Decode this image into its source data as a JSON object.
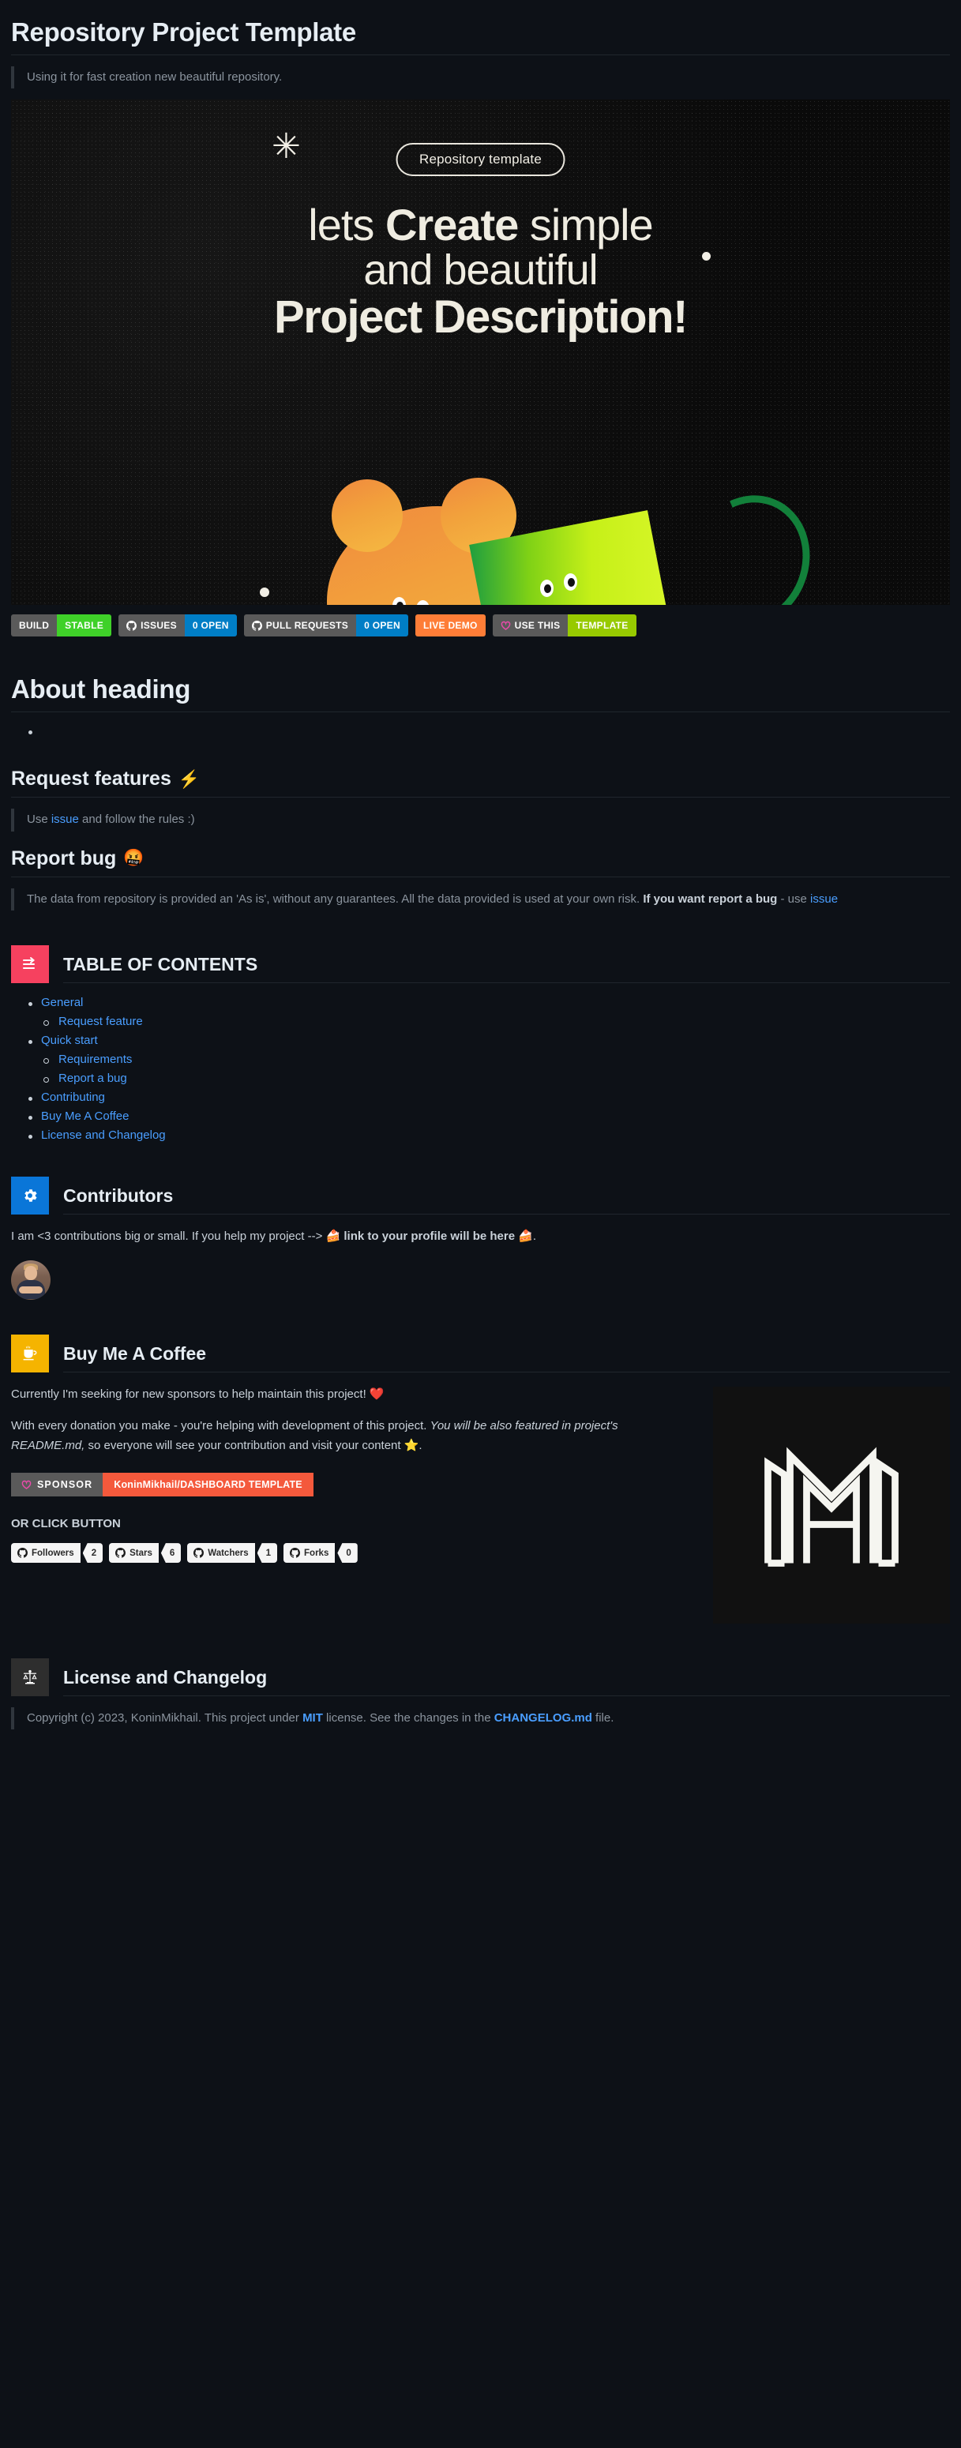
{
  "page": {
    "title": "Repository Project Template",
    "subtitle": "Using it for fast creation new beautiful repository."
  },
  "hero": {
    "pill_label": "Repository template",
    "line1_plain_a": "lets ",
    "line1_bold": "Create",
    "line1_plain_b": " simple",
    "line2": "and beautiful",
    "line3": "Project Description!"
  },
  "badges": [
    {
      "left": "BUILD",
      "right": "STABLE",
      "right_color": "#3fd129",
      "icon": ""
    },
    {
      "left": "ISSUES",
      "right": "0 OPEN",
      "right_color": "#007ec6",
      "icon": "github-icon"
    },
    {
      "left": "PULL REQUESTS",
      "right": "0 OPEN",
      "right_color": "#007ec6",
      "icon": "github-icon"
    },
    {
      "left": "LIVE DEMO",
      "right": "",
      "right_color": "",
      "icon": "",
      "solo_color": "#fe7d37"
    },
    {
      "left": "USE THIS",
      "right": "TEMPLATE",
      "right_color": "#97ca00",
      "icon": "heart-icon"
    }
  ],
  "about": {
    "heading": "About heading",
    "items": [
      ""
    ]
  },
  "request_features": {
    "heading": "Request features",
    "emoji": "⚡",
    "quote_prefix": "Use ",
    "quote_link": "issue",
    "quote_suffix": " and follow the rules :)"
  },
  "report_bug": {
    "heading": "Report bug",
    "emoji": "🤬",
    "quote_part1": "The data from repository is provided an 'As is', without any guarantees. All the data provided is used at your own risk. ",
    "quote_bold": "If you want report a bug",
    "quote_part2": " - use ",
    "quote_link": "issue"
  },
  "toc": {
    "title": "TABLE OF CONTENTS",
    "icon": "list-arrow-icon",
    "tile_color": "#f6415f",
    "items": [
      {
        "label": "General",
        "children": [
          {
            "label": "Request feature"
          }
        ]
      },
      {
        "label": "Quick start",
        "children": [
          {
            "label": "Requirements"
          },
          {
            "label": "Report a bug"
          }
        ]
      },
      {
        "label": "Contributing",
        "children": []
      },
      {
        "label": "Buy Me A Coffee",
        "children": []
      },
      {
        "label": "License and Changelog",
        "children": []
      }
    ]
  },
  "contributors": {
    "title": "Contributors",
    "icon": "gear-icon",
    "tile_color": "#0a76d8",
    "paragraph_plain": "I am <3 contributions big or small. If you help my project --> ",
    "paragraph_bold": "🍰 link to your profile will be here 🍰",
    "paragraph_end": ".",
    "avatar_alt": "contributor-avatar"
  },
  "coffee": {
    "title": "Buy Me A Coffee",
    "icon": "coffee-cup-icon",
    "tile_color": "#f5b400",
    "p1": "Currently I'm seeking for new sponsors to help maintain this project! ❤️",
    "p2_plain_a": "With every donation you make - you're helping with development of this project. ",
    "p2_italic": "You will be also featured in project's README.md,",
    "p2_plain_b": " so everyone will see your contribution and visit your content ⭐.",
    "sponsor_label": "SPONSOR",
    "sponsor_value": "KoninMikhail/DASHBOARD TEMPLATE",
    "sponsor_icon": "heart-icon",
    "or_click": "OR CLICK BUTTON",
    "logo_alt": "mh-monogram-logo",
    "counters": [
      {
        "label": "Followers",
        "value": "2",
        "icon": "github-icon"
      },
      {
        "label": "Stars",
        "value": "6",
        "icon": "github-icon"
      },
      {
        "label": "Watchers",
        "value": "1",
        "icon": "github-icon"
      },
      {
        "label": "Forks",
        "value": "0",
        "icon": "github-icon"
      }
    ]
  },
  "license": {
    "title": "License and Changelog",
    "icon": "scales-icon",
    "tile_color": "#2e2e2e",
    "copyright_a": "Copyright (c) 2023, KoninMikhail. This project under ",
    "link_mit": "MIT",
    "copyright_b": " license. See the changes in the ",
    "link_changelog": "CHANGELOG.md",
    "copyright_c": " file."
  },
  "colors": {
    "page_bg": "#0d1117",
    "link": "#4a9eff",
    "rule": "#20262d",
    "text": "#c9d1d9",
    "heading": "#e6edf3"
  }
}
